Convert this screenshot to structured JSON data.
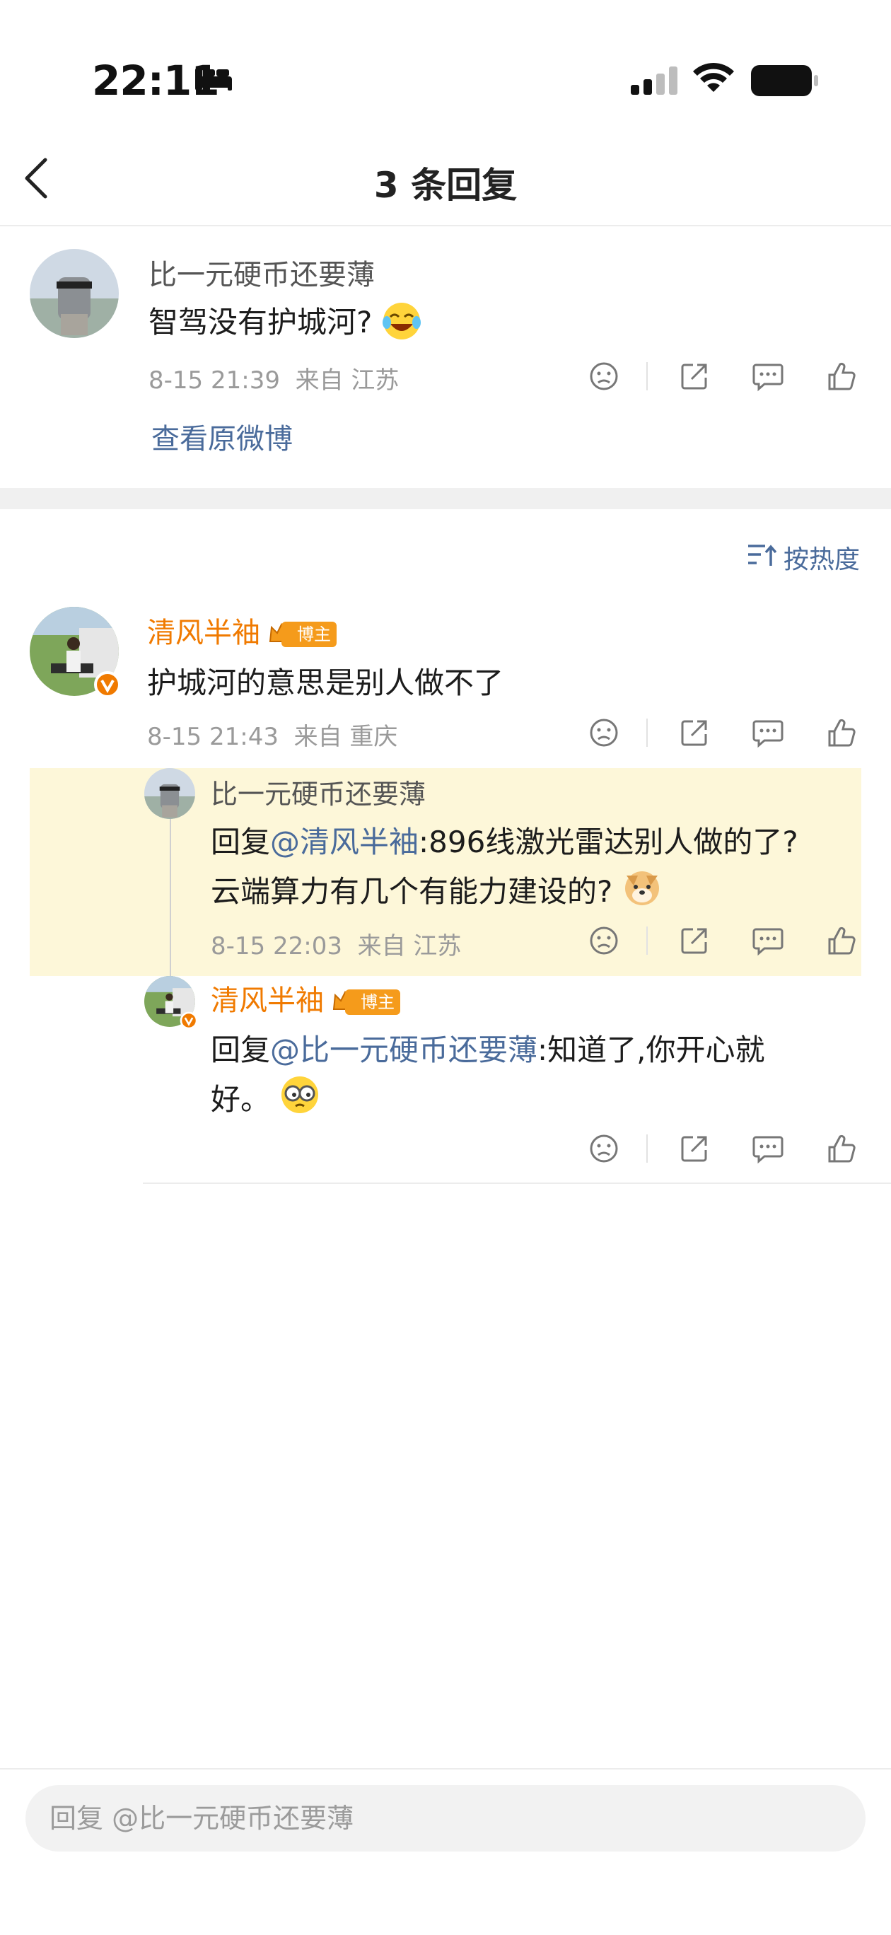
{
  "status_bar": {
    "time": "22:11"
  },
  "nav": {
    "title": "3 条回复"
  },
  "original": {
    "author": "比一元硬币还要薄",
    "text": "智驾没有护城河?",
    "time": "8-15 21:39",
    "location": "来自 江苏",
    "view_original": "查看原微博"
  },
  "sort": {
    "label": "按热度"
  },
  "comments": [
    {
      "author": "清风半袖",
      "badge": "博主",
      "text": "护城河的意思是别人做不了",
      "time": "8-15 21:43",
      "location": "来自 重庆"
    },
    {
      "author": "比一元硬币还要薄",
      "reply_prefix": "回复",
      "mention": "@清风半袖",
      "text_line1": ":896线激光雷达别人做的了?",
      "text_line2": "云端算力有几个有能力建设的?",
      "time": "8-15 22:03",
      "location": "来自 江苏"
    },
    {
      "author": "清风半袖",
      "badge": "博主",
      "reply_prefix": "回复",
      "mention": "@比一元硬币还要薄",
      "text_line1": ":知道了,你开心就",
      "text_line2": "好。"
    }
  ],
  "reply_box": {
    "placeholder": "回复 @比一元硬币还要薄"
  },
  "icons": {
    "dislike": "sad-face-icon",
    "share": "share-icon",
    "comment": "comment-icon",
    "like": "thumbs-up-icon"
  },
  "colors": {
    "accent_orange": "#f07a00",
    "link_blue": "#4a6b9b",
    "highlight": "#fdf7d9"
  }
}
